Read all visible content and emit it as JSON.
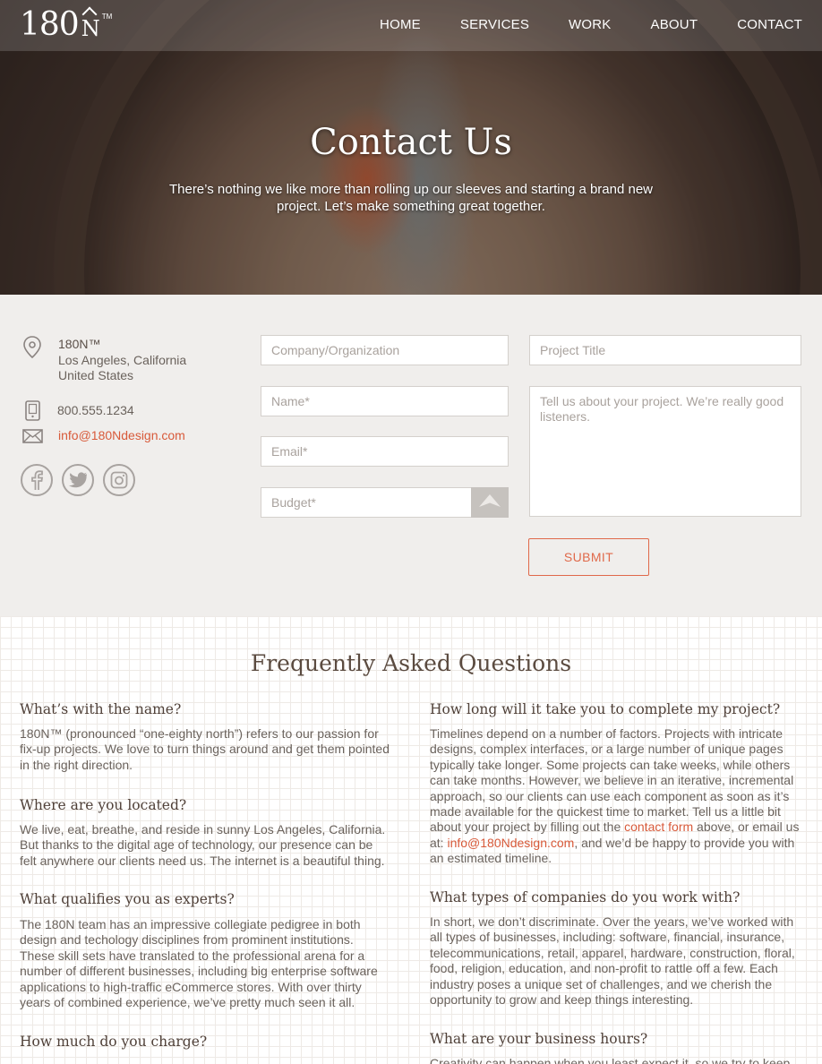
{
  "brand": {
    "logo_num": "180",
    "logo_n": "N",
    "logo_tm": "TM"
  },
  "nav": {
    "items": [
      "HOME",
      "SERVICES",
      "WORK",
      "ABOUT",
      "CONTACT"
    ]
  },
  "hero": {
    "title": "Contact Us",
    "subtitle": "There’s nothing we like more than rolling up our sleeves and starting a brand new project.  Let’s make something great together."
  },
  "contact_info": {
    "company": "180N™",
    "city": "Los Angeles, California",
    "country": "United States",
    "phone": "800.555.1234",
    "email": "info@180Ndesign.com"
  },
  "social": [
    "facebook-icon",
    "twitter-icon",
    "instagram-icon"
  ],
  "form": {
    "company_placeholder": "Company/Organization",
    "name_placeholder": "Name*",
    "email_placeholder": "Email*",
    "budget_placeholder": "Budget*",
    "project_title_placeholder": "Project Title",
    "message_placeholder": "Tell us about your project. We’re really good listeners.",
    "submit_label": "SUBMIT"
  },
  "faq": {
    "title": "Frequently Asked Questions",
    "left": [
      {
        "q": "What’s with the name?",
        "a": "180N™ (pronounced “one-eighty north”) refers to our passion for fix-up projects. We love to turn things around and get them pointed in the right direction."
      },
      {
        "q": "Where are you located?",
        "a": "We live, eat, breathe, and reside in sunny Los Angeles, California. But thanks to the digital age of technology, our presence can be felt anywhere our clients need us. The internet is a beautiful thing."
      },
      {
        "q": "What qualifies you as experts?",
        "a": "The 180N team has an impressive collegiate pedigree in both design and techology disciplines from prominent institutions. These skill sets have translated to the professional arena for a number of different businesses, including big enterprise software applications to high-traffic eCommerce stores. With over thirty years of combined experience, we’ve pretty much seen it all."
      },
      {
        "q": "How much do you charge?",
        "a": ""
      }
    ],
    "right": [
      {
        "q": "How long will it take you to complete my project?",
        "a_pre": "Timelines depend on a number of factors. Projects with intricate designs, complex interfaces, or a large number of unique pages typically take longer. Some projects can take weeks, while others can take months. However, we believe in an iterative, incremental approach, so our clients can use each component as soon as it’s made available for the quickest time to market. Tell us a little bit about your project by filling out the ",
        "link1": "contact form",
        "a_mid": " above, or email us at: ",
        "link2": "info@180Ndesign.com",
        "a_post": ", and we’d be happy to provide you with an estimated timeline."
      },
      {
        "q": "What types of companies do you work with?",
        "a": "In short, we don’t discriminate. Over the years, we’ve worked with all types of businesses, including: software, financial, insurance, telecommunications, retail, apparel, hardware, construction, floral, food, religion, education, and non-profit to rattle off a few. Each industry poses a unique set of challenges, and we cherish the opportunity to grow and keep things interesting."
      },
      {
        "q": "What are your business hours?",
        "a": "Creativity can happen when you least expect it, so we try to keep"
      }
    ]
  }
}
